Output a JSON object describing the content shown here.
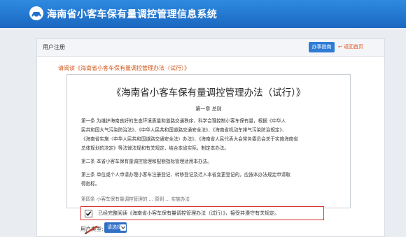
{
  "header": {
    "system_title": "海南省小客车保有量调控管理信息系统"
  },
  "panel": {
    "title": "用户注册",
    "guide_button": "办事指南",
    "back_link": "↩ 返回首页"
  },
  "notice": "请阅读《海南省小客车保有量调控管理办法（试行）》",
  "document": {
    "title": "《海南省小客车保有量调控管理办法（试行）》",
    "chapter": "第一章  总则",
    "paragraphs": [
      "第一条  为维护海南良好的生态环境质量和道路交通秩序，科学合理控制小客车保有量，根据《中华人",
      "民共和国大气污染防治法》、《中华人民共和国道路交通安全法》、《海南省机动车排气污染防治规定》、",
      "《海南省实施〈中华人民共和国道路交通安全法〉办法》、《海南省人民代表大会常务委员会关于实施海南省",
      "总体规划的决定》等法律法规和有关规定，结合本省实际，制定本办法。",
      "第二条  本省小客车保有量调控管理和配额指标管理适用本办法。",
      "第三条  单位或个人申请办理小客车注册登记、转移登记及迁入本省变更登记的，应按本办法规定申请取",
      "得指标。",
      "第四条  小客车保有量调控管理的 ... 原则 ... 实施办法"
    ]
  },
  "agreement": {
    "checked": true,
    "text": "已经完整阅读《海南省小客车保有量调控管理办法（试行）》，接受并遵守有关规定。"
  },
  "user_type": {
    "label": "用户类型:",
    "value": "请选择"
  },
  "colors": {
    "header": "#1f73cc",
    "accent": "#d3571a",
    "highlight_border": "#d8302a"
  }
}
